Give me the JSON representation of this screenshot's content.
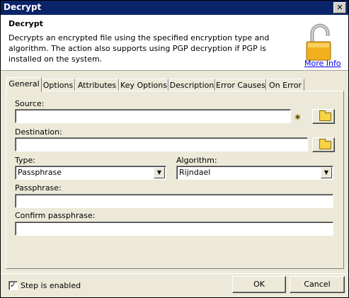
{
  "window": {
    "title": "Decrypt",
    "close_glyph": "✕"
  },
  "header": {
    "title": "Decrypt",
    "description": "Decrypts an encrypted file using the specified encryption type and algorithm.  The action also supports using PGP decryption if PGP is installed on the system.",
    "more_info": "More Info",
    "icon": "open-padlock-icon"
  },
  "tabs": [
    "General",
    "Options",
    "Attributes",
    "Key Options",
    "Description",
    "Error Causes",
    "On Error"
  ],
  "active_tab": "General",
  "form": {
    "source_label": "Source:",
    "source_value": "",
    "destination_label": "Destination:",
    "destination_value": "",
    "type_label": "Type:",
    "type_value": "Passphrase",
    "algorithm_label": "Algorithm:",
    "algorithm_value": "Rijndael",
    "passphrase_label": "Passphrase:",
    "passphrase_value": "",
    "confirm_label": "Confirm passphrase:",
    "confirm_value": ""
  },
  "footer": {
    "step_enabled_label": "Step is enabled",
    "step_enabled_checked": true,
    "ok_label": "OK",
    "cancel_label": "Cancel"
  },
  "colors": {
    "titlebar": "#0a246a",
    "dialog": "#ece9d8",
    "link": "#0000ee"
  }
}
